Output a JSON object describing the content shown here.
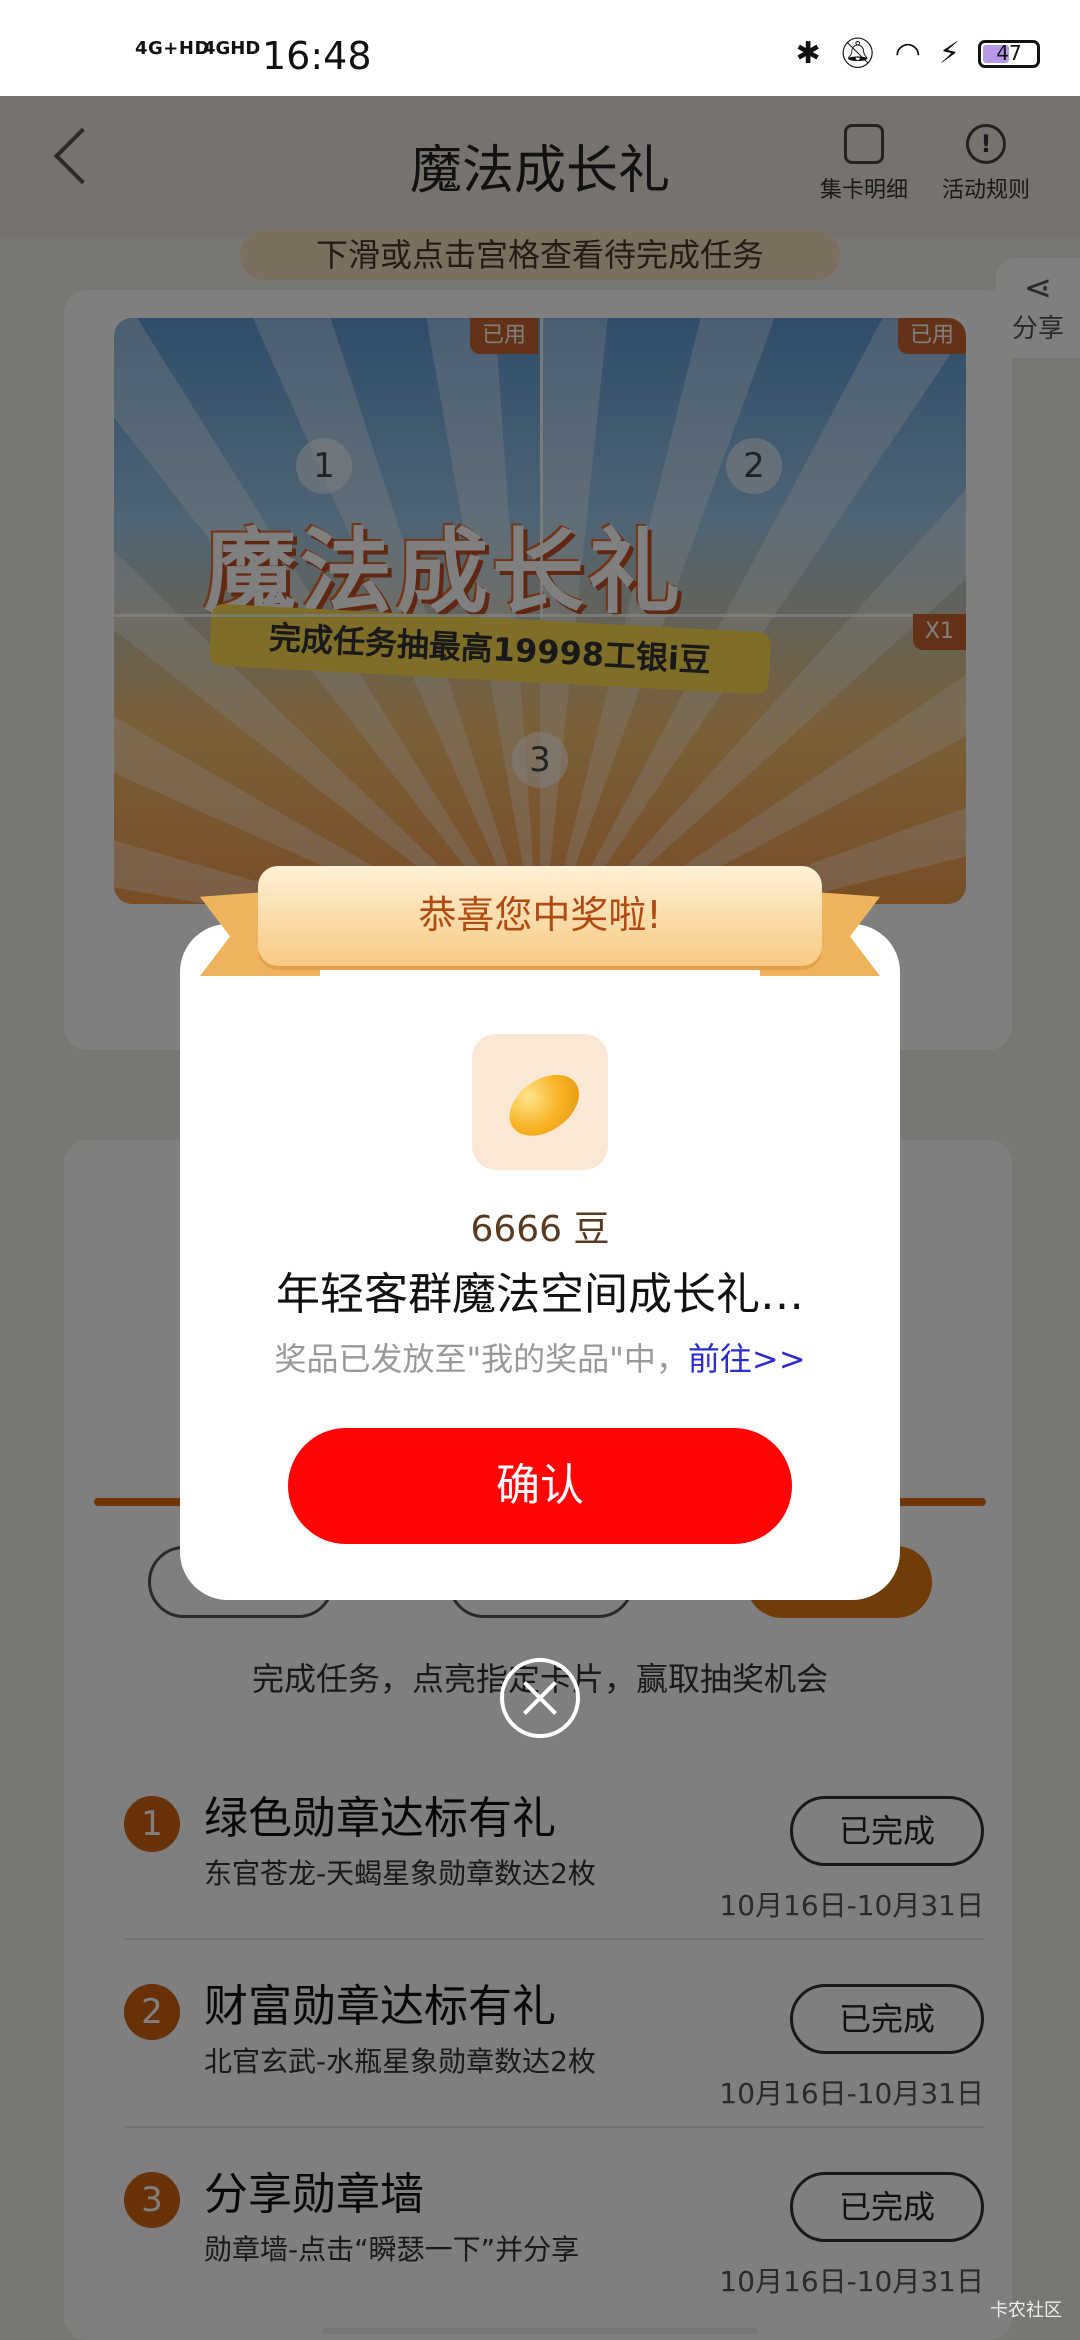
{
  "status_bar": {
    "network_1": "4G+HD",
    "network_2": "4GHD",
    "time": "16:48",
    "battery": "47",
    "battery_level": 0.47
  },
  "header": {
    "title": "魔法成长礼",
    "card_detail_label": "集卡明细",
    "rules_label": "活动规则"
  },
  "hint": "下滑或点击宫格查看待完成任务",
  "share_label": "分享",
  "poster": {
    "title": "魔法成长礼",
    "subtitle": "完成任务抽最高19998工银i豆",
    "used_tag": "已用",
    "multiplier_tag": "X1",
    "cells": [
      "1",
      "2",
      "3"
    ]
  },
  "instruction": "完成任务，点亮指定卡片，赢取抽奖机会",
  "tasks": [
    {
      "num": "1",
      "name": "绿色勋章达标有礼",
      "desc": "东官苍龙-天蝎星象勋章数达2枚",
      "status": "已完成",
      "date": "10月16日-10月31日"
    },
    {
      "num": "2",
      "name": "财富勋章达标有礼",
      "desc": "北官玄武-水瓶星象勋章数达2枚",
      "status": "已完成",
      "date": "10月16日-10月31日"
    },
    {
      "num": "3",
      "name": "分享勋章墙",
      "desc": "勋章墙-点击“瞬瑟一下”并分享",
      "status": "已完成",
      "date": "10月16日-10月31日"
    }
  ],
  "modal": {
    "banner": "恭喜您中奖啦!",
    "prize_amount": "6666 豆",
    "prize_name": "年轻客群魔法空间成长礼…",
    "note": "奖品已发放至\"我的奖品\"中，",
    "link": "前往>>",
    "confirm": "确认"
  },
  "watermark": "卡农社区"
}
